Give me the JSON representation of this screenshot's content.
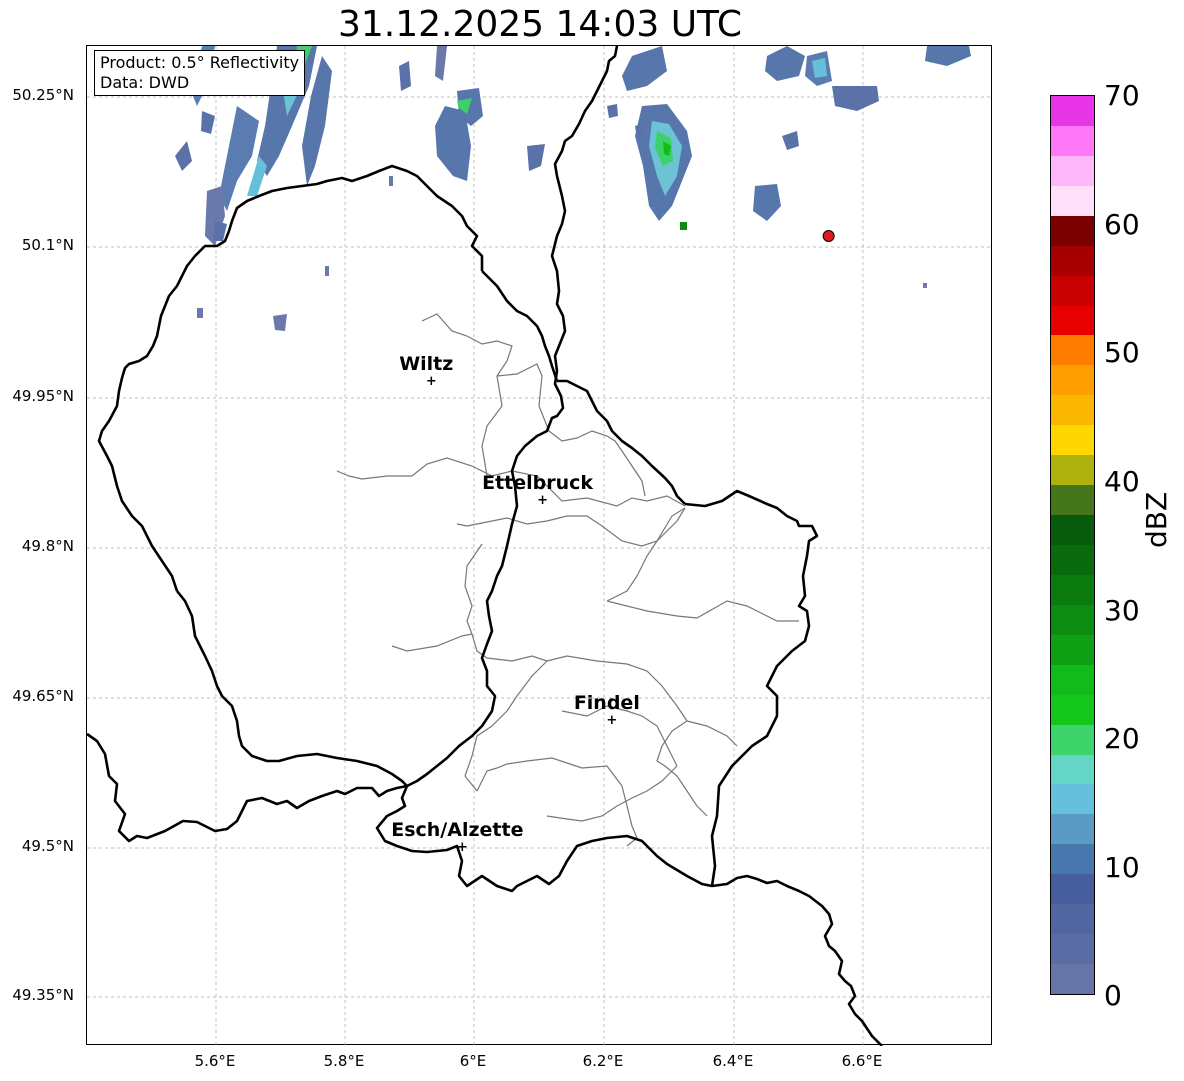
{
  "title": "31.12.2025 14:03 UTC",
  "info": {
    "product": "Product: 0.5° Reflectivity",
    "data": "Data: DWD"
  },
  "lat_labels": [
    "50.25°N",
    "50.1°N",
    "49.95°N",
    "49.8°N",
    "49.65°N",
    "49.5°N",
    "49.35°N"
  ],
  "lon_labels": [
    "5.6°E",
    "5.8°E",
    "6°E",
    "6.2°E",
    "6.4°E",
    "6.6°E"
  ],
  "cities": [
    {
      "name": "Wiltz",
      "lon": 5.932,
      "lat": 49.966
    },
    {
      "name": "Ettelbruck",
      "lon": 6.104,
      "lat": 49.847
    },
    {
      "name": "Findel",
      "lon": 6.211,
      "lat": 49.627
    },
    {
      "name": "Esch/Alzette",
      "lon": 5.98,
      "lat": 49.5
    }
  ],
  "marker": {
    "lon": 6.546,
    "lat": 50.11,
    "color": "#e31a1c"
  },
  "colorbar": {
    "label": "dBZ",
    "ticks": [
      "0",
      "10",
      "20",
      "30",
      "40",
      "50",
      "60",
      "70"
    ],
    "colors": [
      "#6674a8",
      "#5a6ca4",
      "#4f66a0",
      "#465e9e",
      "#4877ae",
      "#5a9ac4",
      "#67c0db",
      "#64d6c7",
      "#3dd46b",
      "#15c71d",
      "#11bc1a",
      "#0f9f15",
      "#0c8d12",
      "#0b7a0f",
      "#096b0e",
      "#085a0c",
      "#45761b",
      "#adb30c",
      "#ffd600",
      "#fbb600",
      "#ff9e00",
      "#ff7b00",
      "#e60000",
      "#c70000",
      "#a60000",
      "#7a0000",
      "#ffe0fb",
      "#ffb7fb",
      "#ff78f7",
      "#e835e8"
    ]
  }
}
